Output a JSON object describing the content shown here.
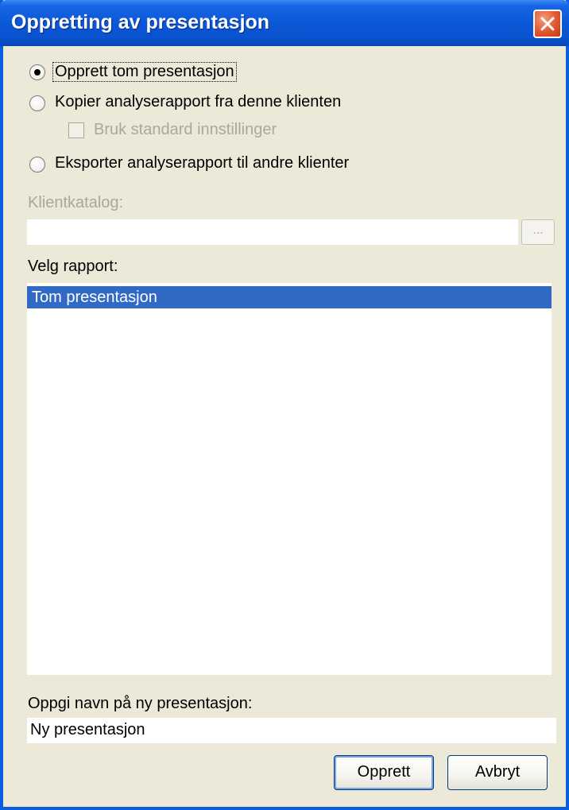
{
  "window": {
    "title": "Oppretting av presentasjon"
  },
  "options": {
    "create_empty": "Opprett tom presentasjon",
    "copy_report": "Kopier analyserapport fra denne klienten",
    "use_default_settings": "Bruk standard innstillinger",
    "export_report": "Eksporter analyserapport til andre klienter",
    "selected": "create_empty"
  },
  "client_catalog": {
    "label": "Klientkatalog:",
    "value": "",
    "browse_label": "..."
  },
  "report": {
    "label": "Velg rapport:",
    "items": [
      "Tom presentasjon"
    ],
    "selected_index": 0
  },
  "name_field": {
    "label": "Oppgi navn på ny presentasjon:",
    "value": "Ny presentasjon"
  },
  "buttons": {
    "create": "Opprett",
    "cancel": "Avbryt"
  },
  "colors": {
    "titlebar": "#0a58d8",
    "selection": "#316ac5",
    "dialog_bg": "#ece9d8"
  }
}
